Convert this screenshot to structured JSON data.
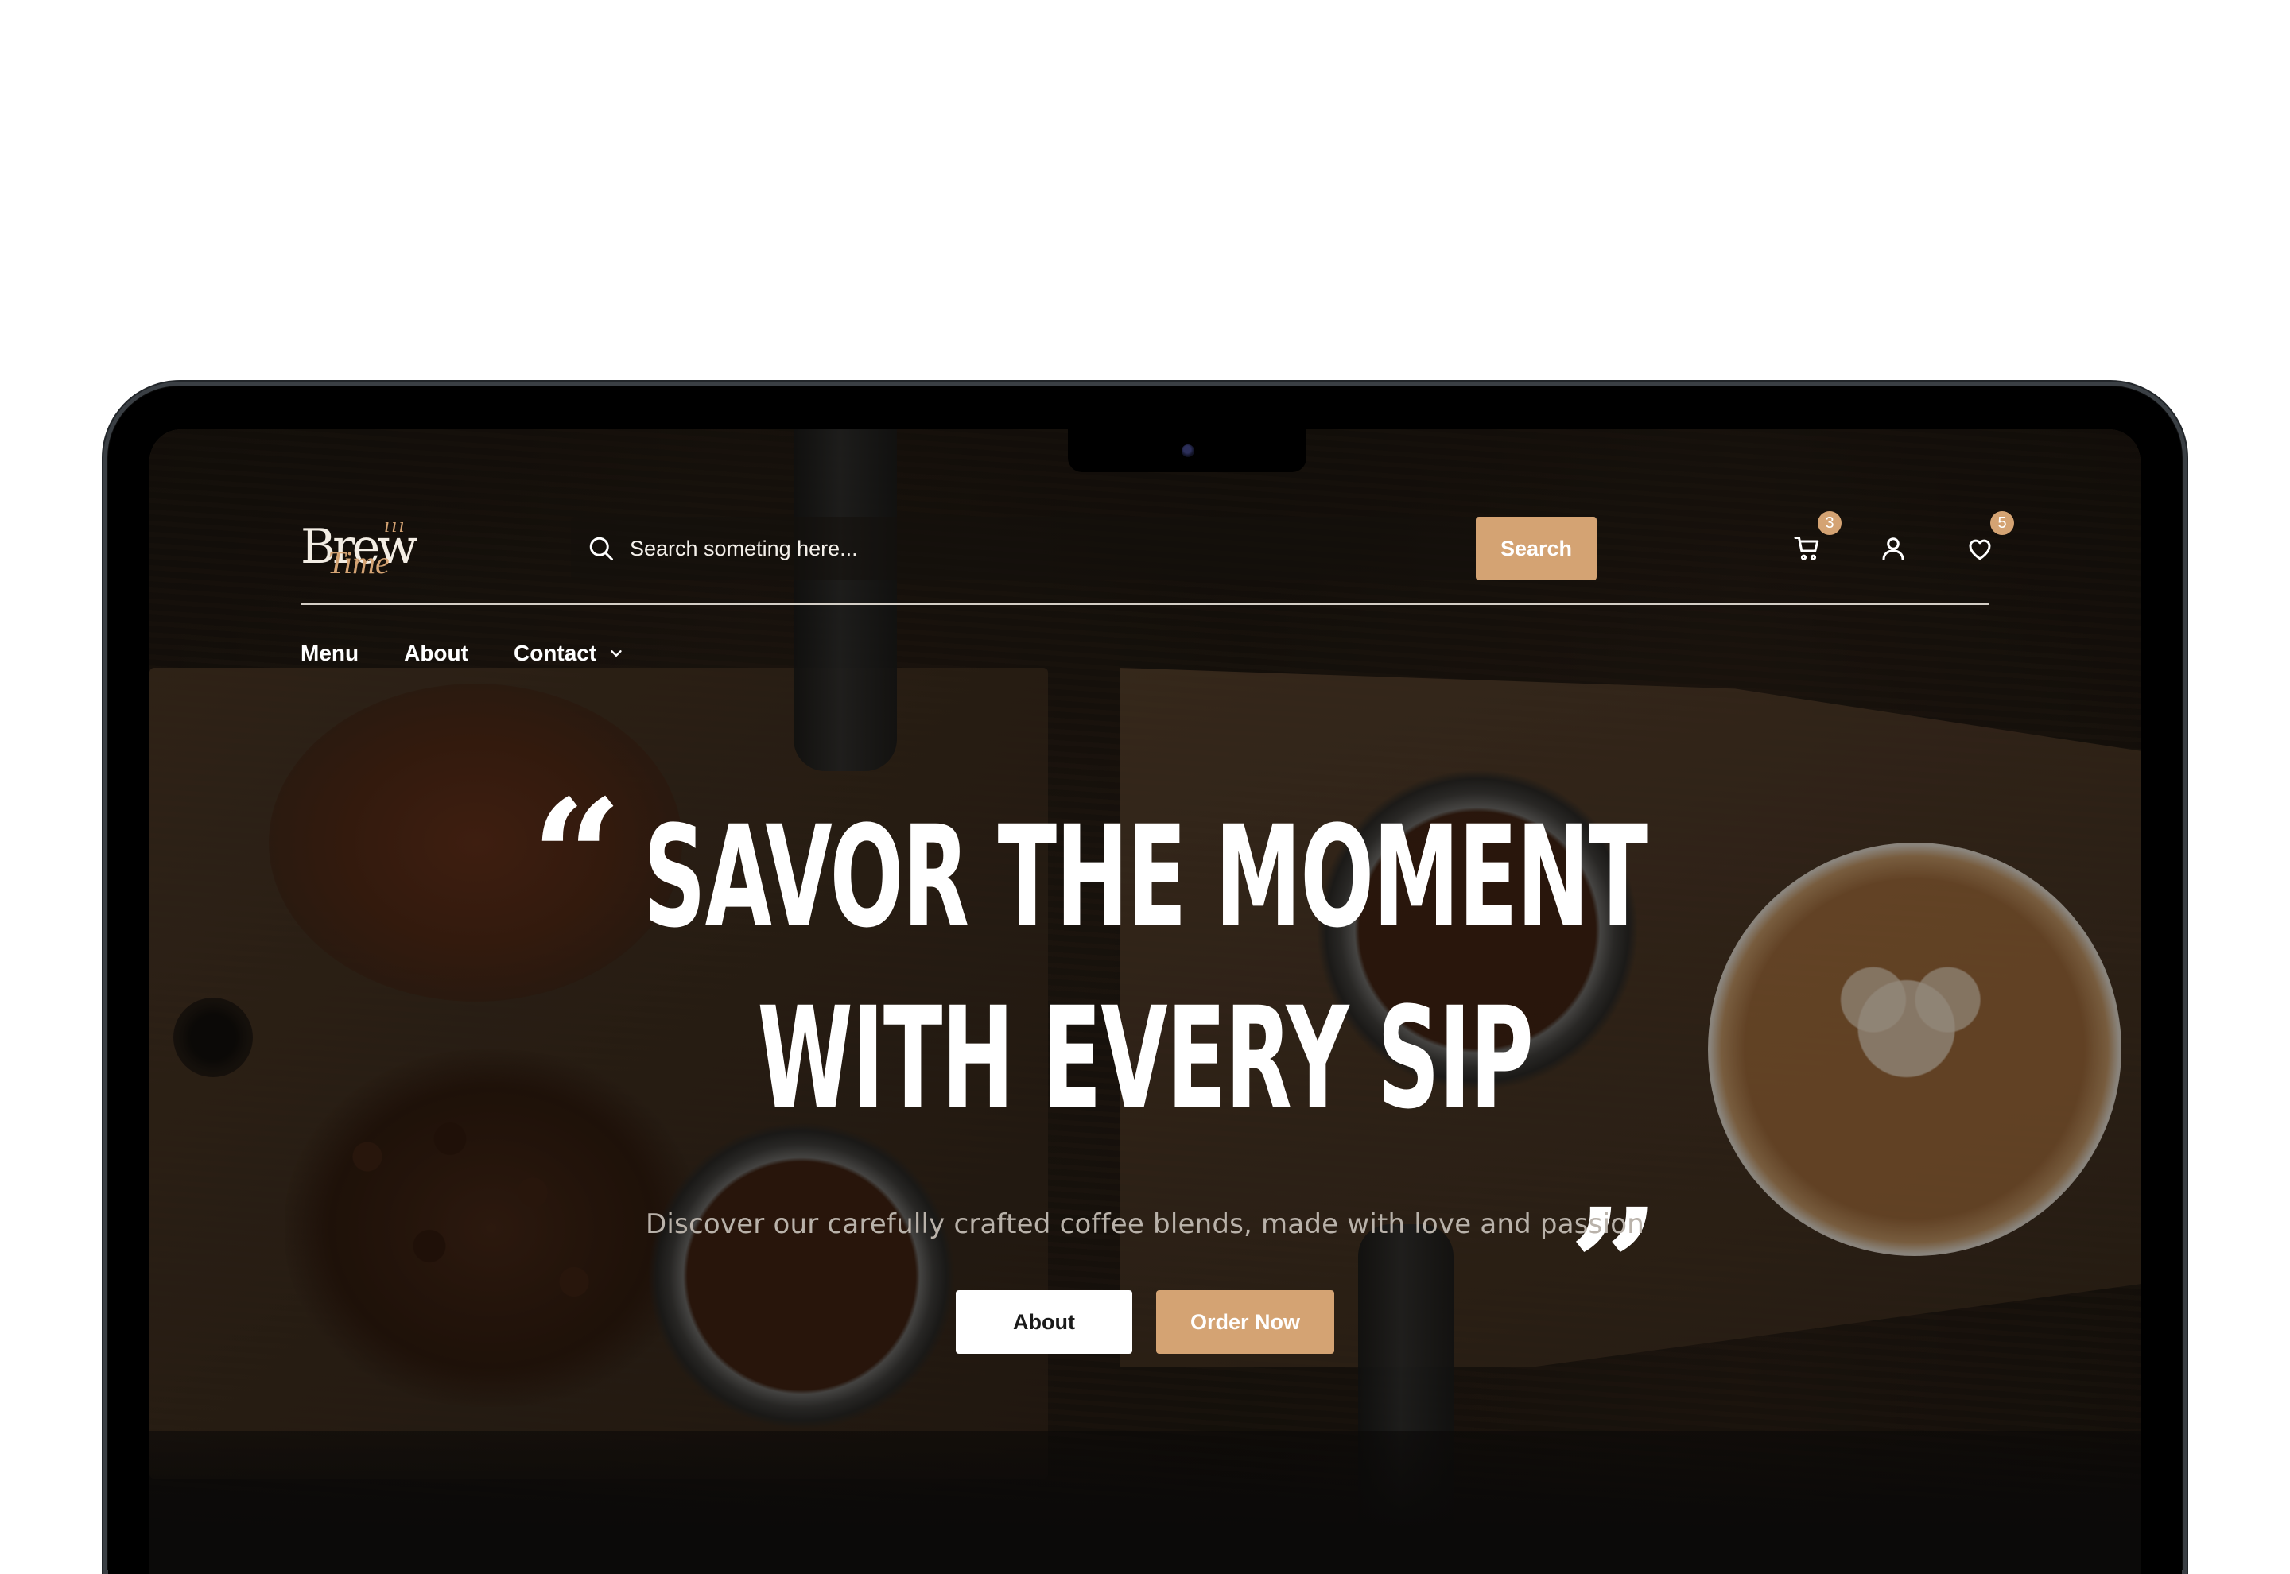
{
  "brand": {
    "logo_main": "Brew",
    "logo_sub": "Time",
    "logo_marks": "ııı",
    "accent_color": "#d4a373"
  },
  "header": {
    "search_placeholder": "Search someting here...",
    "search_button": "Search",
    "cart_count": "3",
    "wishlist_count": "5",
    "icons": [
      "search-icon",
      "cart-icon",
      "user-icon",
      "heart-icon",
      "chevron-down-icon"
    ]
  },
  "nav": {
    "items": [
      {
        "label": "Menu"
      },
      {
        "label": "About"
      },
      {
        "label": "Contact"
      }
    ]
  },
  "hero": {
    "line1": "SAVOR THE MOMENT",
    "line2": "WITH EVERY SIP",
    "quote_open": "“",
    "quote_close": "„",
    "subtitle": "Discover our carefully crafted coffee blends, made with love and passion",
    "btn_about": "About",
    "btn_order": "Order Now"
  }
}
